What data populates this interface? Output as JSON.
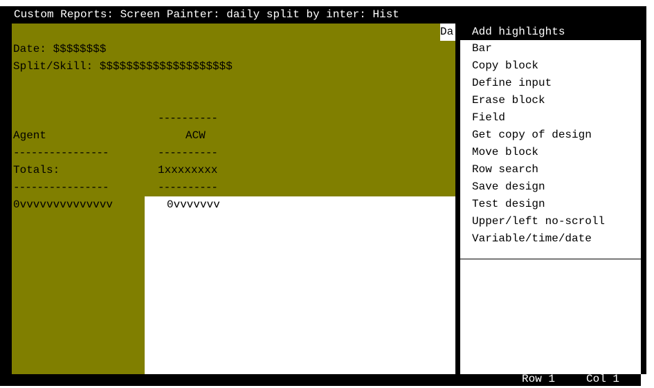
{
  "title": "Custom Reports: Screen Painter: daily split by inter: Hist",
  "canvas": {
    "truncated_label": "Da",
    "date_line": "Date: $$$$$$$$",
    "split_line": "Split/Skill: $$$$$$$$$$$$$$$$$$$$",
    "dash_short": "----------",
    "col_agent": "Agent",
    "col_acw": "ACW",
    "dash_left": "----------------",
    "dash_right": "----------",
    "totals_label": "Totals:",
    "totals_value": "1xxxxxxxx",
    "agent_field": "0vvvvvvvvvvvvvv",
    "acw_field": "0vvvvvvv"
  },
  "menu": {
    "header": "Add highlights",
    "items": [
      "Bar",
      "Copy block",
      "Define input",
      "Erase block",
      "Field",
      "Get copy of design",
      "Move block",
      "Row search",
      "Save design",
      "Test design",
      "Upper/left no-scroll",
      "Variable/time/date"
    ]
  },
  "status": {
    "row": "Row 1",
    "col": "Col 1"
  }
}
